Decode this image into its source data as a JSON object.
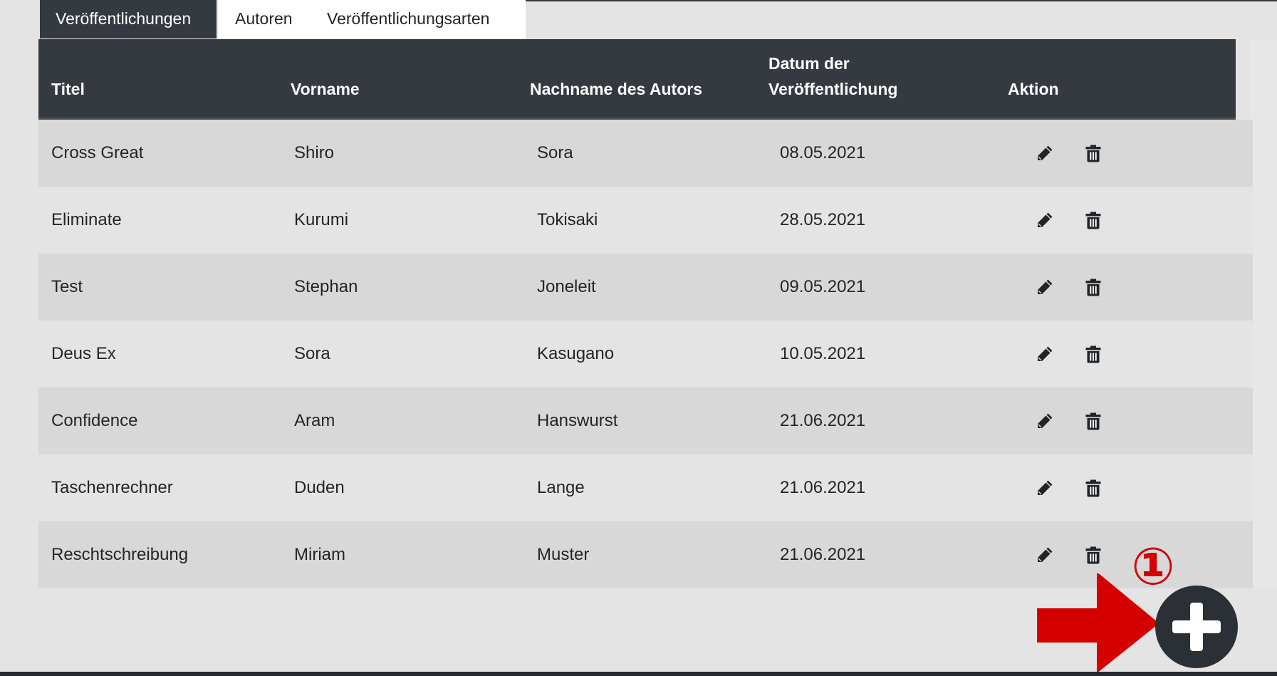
{
  "tabs": [
    {
      "label": "Veröffentlichungen",
      "active": true
    },
    {
      "label": "Autoren",
      "active": false
    },
    {
      "label": "Veröffentlichungsarten",
      "active": false
    }
  ],
  "table": {
    "headers": {
      "title": "Titel",
      "firstname": "Vorname",
      "lastname": "Nachname des Autors",
      "date_line1": "Datum der",
      "date_line2": "Veröffentlichung",
      "action": "Aktion"
    },
    "rows": [
      {
        "title": "Cross Great",
        "firstname": "Shiro",
        "lastname": "Sora",
        "date": "08.05.2021"
      },
      {
        "title": "Eliminate",
        "firstname": "Kurumi",
        "lastname": "Tokisaki",
        "date": "28.05.2021"
      },
      {
        "title": "Test",
        "firstname": "Stephan",
        "lastname": "Joneleit",
        "date": "09.05.2021"
      },
      {
        "title": "Deus Ex",
        "firstname": "Sora",
        "lastname": "Kasugano",
        "date": "10.05.2021"
      },
      {
        "title": "Confidence",
        "firstname": "Aram",
        "lastname": "Hanswurst",
        "date": "21.06.2021"
      },
      {
        "title": "Taschenrechner",
        "firstname": "Duden",
        "lastname": "Lange",
        "date": "21.06.2021"
      },
      {
        "title": "Reschtschreibung",
        "firstname": "Miriam",
        "lastname": "Muster",
        "date": "21.06.2021"
      }
    ],
    "row_actions": [
      "pencil-icon",
      "trash-icon"
    ]
  },
  "annotation": {
    "step_number": "①",
    "arrow_color": "#d40000",
    "target": "add-button"
  },
  "add_button": {
    "icon": "plus-icon"
  },
  "colors": {
    "header_bg": "#343a40",
    "page_bg": "#e4e4e4",
    "row_stripe": "#d8d8d8",
    "active_tab_bg": "#343a40"
  }
}
